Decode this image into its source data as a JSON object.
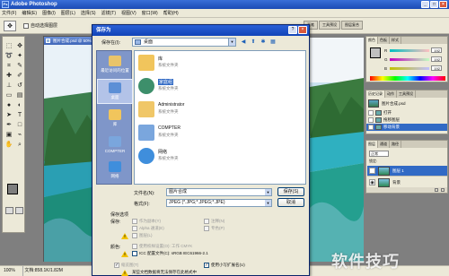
{
  "app": {
    "title": "Adobe Photoshop",
    "logo_text": "Ps",
    "menu": [
      "文件(F)",
      "编辑(E)",
      "图像(I)",
      "图层(L)",
      "选择(S)",
      "滤镜(T)",
      "视图(V)",
      "窗口(W)",
      "帮助(H)"
    ],
    "options_bar": {
      "checkbox_label": "自动选择图层",
      "dock_tabs": [
        "画笔",
        "工具预设",
        "图层复合"
      ]
    }
  },
  "document": {
    "title": "图片合成.psd @ 50% (背景, RGB/8)"
  },
  "status_bar": {
    "zoom": "100%",
    "doc_info": "文档:858.1K/1.82M"
  },
  "color_panel": {
    "tabs": [
      "颜色",
      "色板",
      "样式"
    ],
    "channels": [
      {
        "name": "R",
        "value": "192"
      },
      {
        "name": "G",
        "value": "192"
      },
      {
        "name": "B",
        "value": "192"
      }
    ]
  },
  "history_panel": {
    "tabs": [
      "历史记录",
      "动作",
      "工具预设"
    ],
    "snapshot": "图片合成.psd",
    "items": [
      "打开",
      "拖移图层",
      "移动背景"
    ],
    "selected_index": 2
  },
  "layers_panel": {
    "tabs": [
      "图层",
      "通道",
      "路径"
    ],
    "blend_mode": "正常",
    "lock_label": "锁定:",
    "layers": [
      {
        "name": "图层 1",
        "selected": true
      },
      {
        "name": "背景",
        "selected": false
      }
    ]
  },
  "dialog": {
    "title": "保存为",
    "save_in_label": "保存在(I):",
    "save_in_value": "桌面",
    "nav": [
      "◀",
      "⬆",
      "✱",
      "▦"
    ],
    "places": [
      {
        "label": "最近访问的位置",
        "color": "#e9c46a"
      },
      {
        "label": "桌面",
        "color": "#5c8fd6"
      },
      {
        "label": "库",
        "color": "#f1c55c"
      },
      {
        "label": "COMPTER",
        "color": "#7aa6dd"
      },
      {
        "label": "网络",
        "color": "#3f8edc"
      }
    ],
    "files": [
      {
        "name": "库",
        "desc": "系统文件夹",
        "color": "#f1c55c"
      },
      {
        "name": "家庭组",
        "desc": "系统文件夹",
        "color": "#3d8f6b",
        "selected": true
      },
      {
        "name": "Administrator",
        "desc": "系统文件夹",
        "color": "#f0c768"
      },
      {
        "name": "COMPTER",
        "desc": "系统文件夹",
        "color": "#7aa6dd"
      },
      {
        "name": "网络",
        "desc": "系统文件夹",
        "color": "#3f8edc"
      }
    ],
    "filename_label": "文件名(N):",
    "filename_value": "图片合成",
    "format_label": "格式(F):",
    "format_value": "JPEG (*.JPG;*.JPEG;*.JPE)",
    "save_button": "保存(S)",
    "cancel_button": "取消",
    "save_options_label": "保存选项",
    "save_label": "保存:",
    "options": {
      "as_copy": "作为副本(Y)",
      "annotations": "注释(N)",
      "alpha": "Alpha 通道(E)",
      "spot": "专色(P)",
      "layers": "图层(L)"
    },
    "color_label": "颜色:",
    "proof_setup": "使用校样设置(O): 工作 CMYK",
    "icc_profile": "ICC 配置文件(C): sRGB IEC61966-2.1",
    "thumbnail": "缩览图(T)",
    "lowercase_ext": "使用小写扩展名(U)",
    "warning_text": "某些文档数据将无法保存在此格式中"
  },
  "watermark": "软件技巧"
}
